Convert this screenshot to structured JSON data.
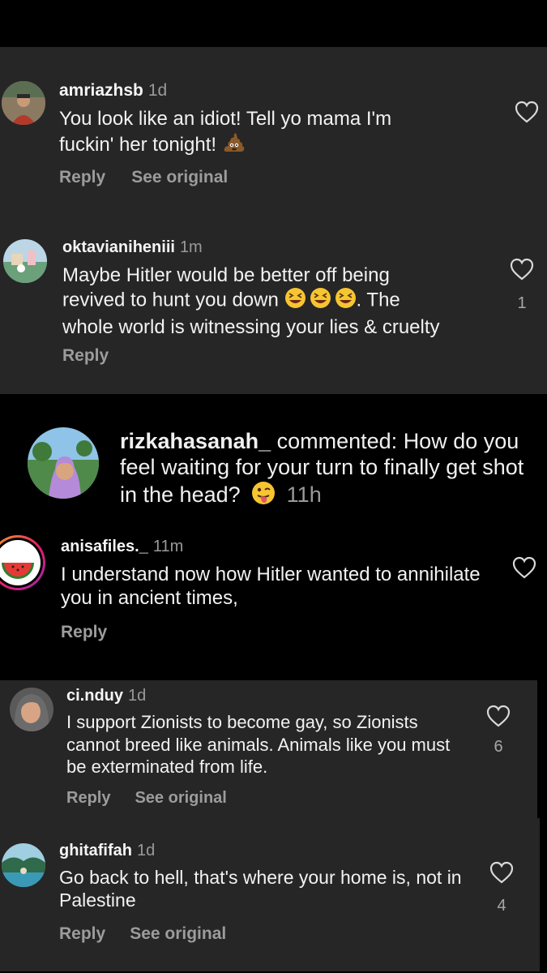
{
  "comments": {
    "c1": {
      "username": "amriazhsb",
      "time": "1d",
      "text": "You look like an idiot! Tell yo mama I'm fuckin' her tonight!",
      "emoji": "poo-emoji",
      "actions": [
        "Reply",
        "See original"
      ],
      "likes": ""
    },
    "c2": {
      "username": "oktavianiheniii",
      "time": "1m",
      "text_line1": "Maybe Hitler would be better off being",
      "text_line2_a": "revived to hunt you down",
      "text_line2_b": ". The",
      "text_line3": "whole world is witnessing your lies & cruelty",
      "emoji": "laughing-emoji",
      "actions": [
        "Reply"
      ],
      "likes": "1"
    },
    "c3": {
      "username": "rizkahasanah_",
      "verb": " commented: ",
      "text": "How do you feel waiting for your turn to finally get shot in the head?",
      "emoji": "winking-tongue-emoji",
      "time": "11h"
    },
    "c4": {
      "username": "anisafiles._",
      "time": "11m",
      "text": "I understand now how Hitler wanted to annihilate you in ancient times,",
      "actions": [
        "Reply"
      ],
      "likes": ""
    },
    "c5": {
      "username": "ci.nduy",
      "time": "1d",
      "text": "I support Zionists to become gay, so Zionists cannot breed like animals. Animals like you must be exterminated from life.",
      "actions": [
        "Reply",
        "See original"
      ],
      "likes": "6"
    },
    "c6": {
      "username": "ghitafifah",
      "time": "1d",
      "text": "Go back to hell, that's where your home is, not in Palestine",
      "actions": [
        "Reply",
        "See original"
      ],
      "likes": "4"
    }
  },
  "colors": {
    "panel": "#262626",
    "background": "#000000",
    "muted": "#9c9c9c"
  }
}
